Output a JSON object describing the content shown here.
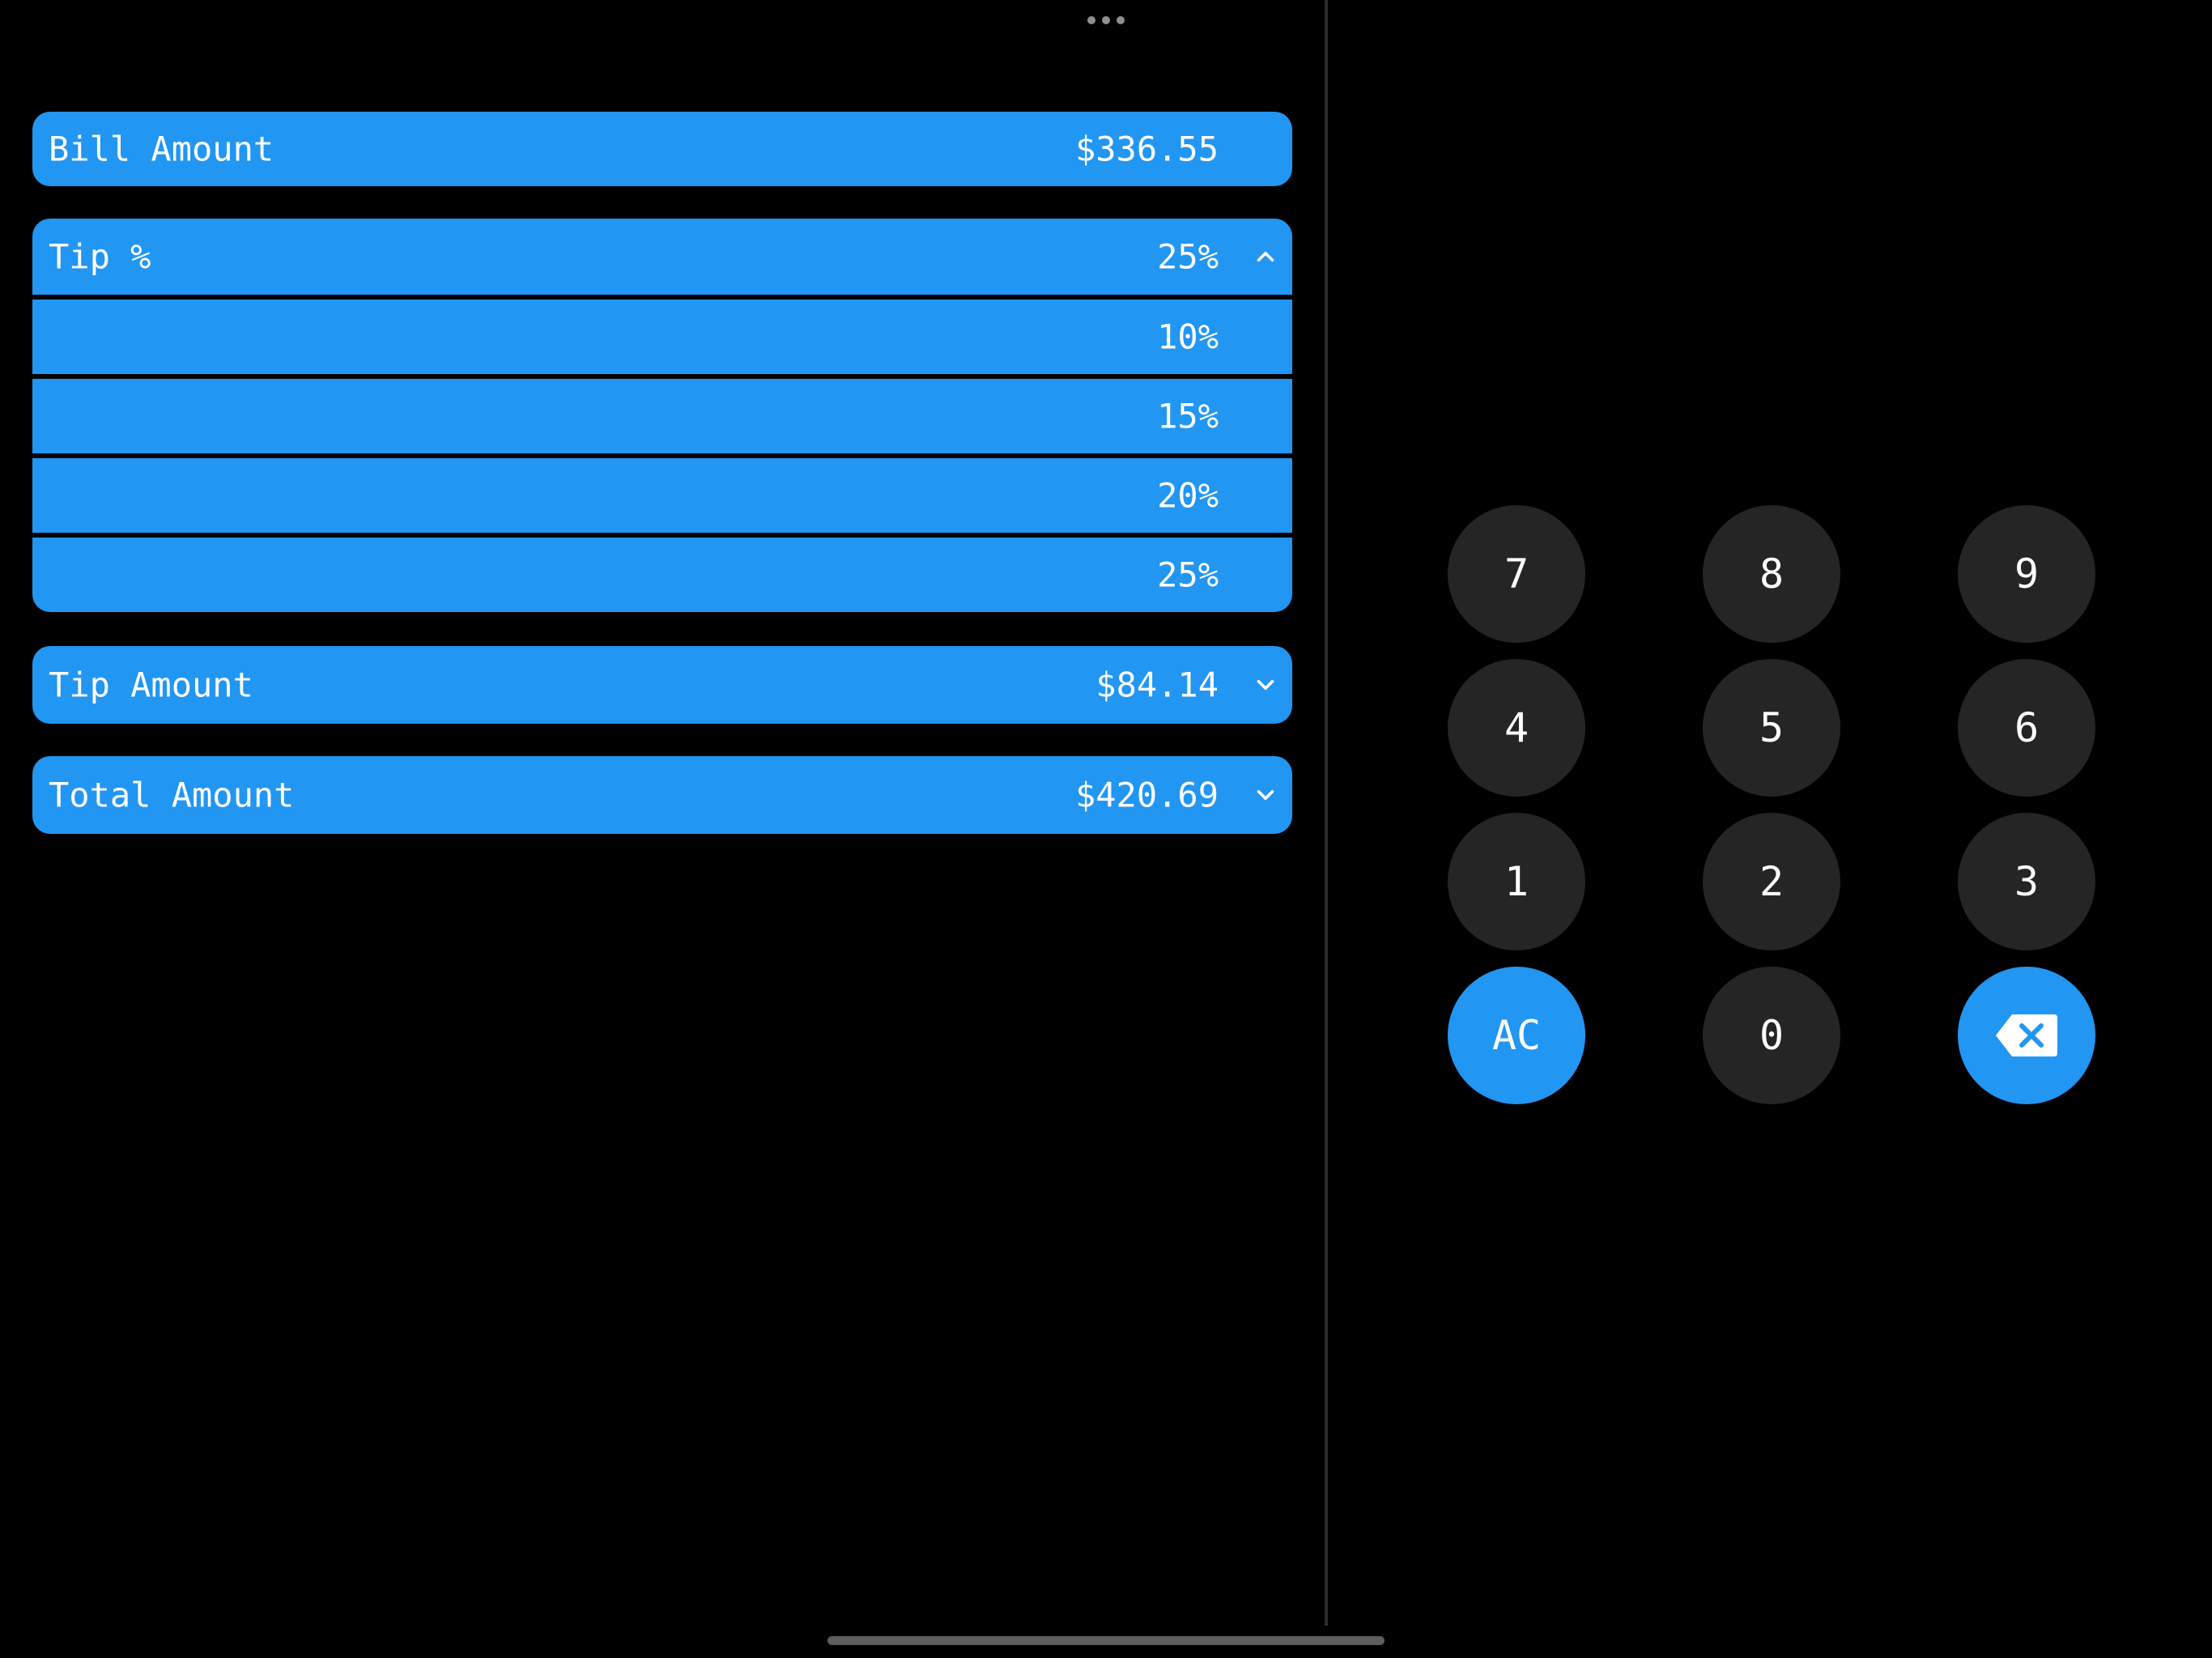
{
  "colors": {
    "accent": "#2196f3",
    "background": "#000000",
    "key_background": "#252525",
    "text": "#ffffff"
  },
  "fields": {
    "bill": {
      "label": "Bill Amount",
      "value": "$336.55"
    },
    "tip_percent": {
      "label": "Tip %",
      "value": "25%",
      "expanded": true,
      "icon": "chevron-up-icon",
      "options": [
        "10%",
        "15%",
        "20%",
        "25%"
      ]
    },
    "tip_amount": {
      "label": "Tip Amount",
      "value": "$84.14",
      "icon": "chevron-down-icon"
    },
    "total": {
      "label": "Total Amount",
      "value": "$420.69",
      "icon": "chevron-down-icon"
    }
  },
  "keypad": {
    "k7": "7",
    "k8": "8",
    "k9": "9",
    "k4": "4",
    "k5": "5",
    "k6": "6",
    "k1": "1",
    "k2": "2",
    "k3": "3",
    "clear": "AC",
    "k0": "0",
    "backspace_icon": "backspace-icon"
  }
}
